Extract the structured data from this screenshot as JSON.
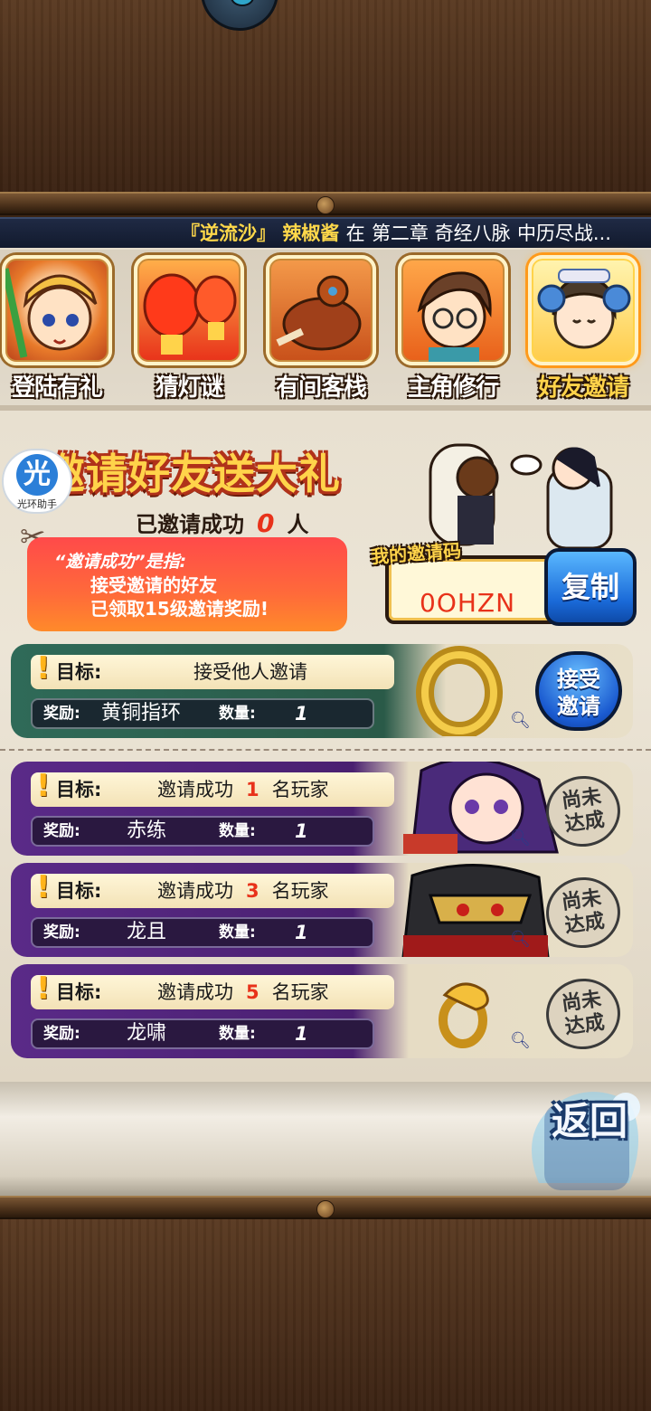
{
  "ticker": {
    "quote_open": "『",
    "part1": "逆流沙",
    "quote_close": "』",
    "name": "辣椒酱",
    "at": "在",
    "chapter": "第二章 奇经八脉",
    "suffix": "中历尽战..."
  },
  "tabs": [
    {
      "label": "登陆有礼",
      "active": false
    },
    {
      "label": "猜灯谜",
      "active": false
    },
    {
      "label": "有间客栈",
      "active": false
    },
    {
      "label": "主角修行",
      "active": false
    },
    {
      "label": "好友邀请",
      "active": true
    }
  ],
  "badge": {
    "big": "光",
    "small": "光环助手"
  },
  "invite": {
    "title": "邀请好友送大礼",
    "success_prefix": "已邀请成功",
    "success_count": "0",
    "success_unit": "人",
    "note_line1": "“邀请成功”是指:",
    "note_line2": "接受邀请的好友",
    "note_line3": "已领取15级邀请奖励!"
  },
  "code": {
    "title": "我的邀请码",
    "value": "0OHZN",
    "copy_label": "复制"
  },
  "rows": [
    {
      "goal_label": "目标:",
      "goal_text": "接受他人邀请",
      "reward_label": "奖励:",
      "reward_name": "黄铜指环",
      "qty_label": "数量:",
      "qty": "1",
      "action": "接受\n邀请"
    },
    {
      "goal_label": "目标:",
      "goal_prefix": "邀请成功",
      "goal_num": "1",
      "goal_suffix": "名玩家",
      "reward_label": "奖励:",
      "reward_name": "赤练",
      "qty_label": "数量:",
      "qty": "1",
      "status": "尚未\n达成"
    },
    {
      "goal_label": "目标:",
      "goal_prefix": "邀请成功",
      "goal_num": "3",
      "goal_suffix": "名玩家",
      "reward_label": "奖励:",
      "reward_name": "龙且",
      "qty_label": "数量:",
      "qty": "1",
      "status": "尚未\n达成"
    },
    {
      "goal_label": "目标:",
      "goal_prefix": "邀请成功",
      "goal_num": "5",
      "goal_suffix": "名玩家",
      "reward_label": "奖励:",
      "reward_name": "龙啸",
      "qty_label": "数量:",
      "qty": "1",
      "status": "尚未\n达成"
    }
  ],
  "back_label": "返回",
  "colors": {
    "accent_gold": "#ffd34a",
    "accent_red": "#e8321a",
    "row_green": "#2f6a58",
    "row_purple": "#5a2a88",
    "button_blue": "#1a6ad8"
  }
}
